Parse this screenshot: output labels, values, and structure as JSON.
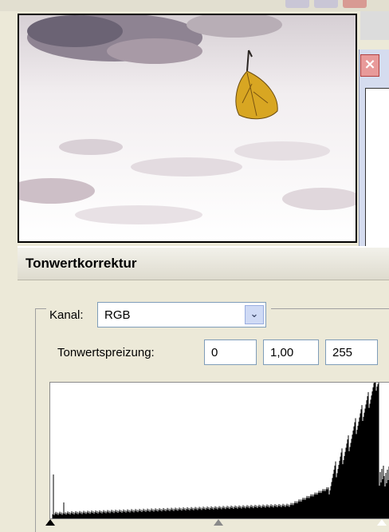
{
  "dialog": {
    "title": "Tonwertkorrektur",
    "channel_label": "Kanal:",
    "channel_value": "RGB",
    "input_levels_label": "Tonwertspreizung:",
    "input_black": "0",
    "input_gamma": "1,00",
    "input_white": "255"
  },
  "histogram": {
    "levels_input_black": 0,
    "levels_input_gamma": 1.0,
    "levels_input_white": 255
  },
  "icons": {
    "close": "close-icon",
    "dropdown": "chevron-down-icon",
    "black_point": "black-triangle-icon",
    "gray_point": "gray-triangle-icon",
    "white_point": "white-triangle-icon"
  }
}
